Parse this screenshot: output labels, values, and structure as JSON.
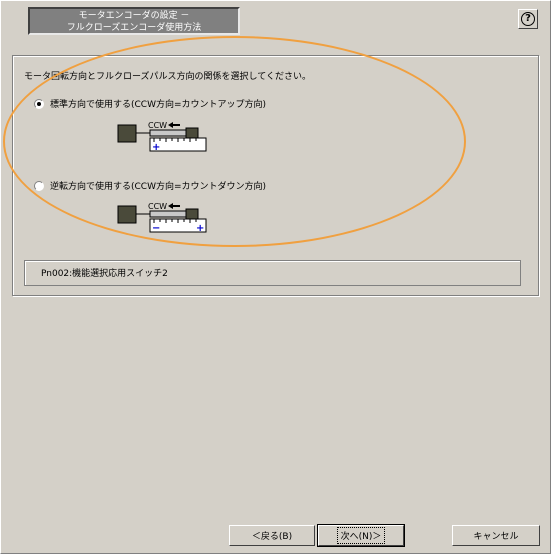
{
  "window": {
    "title_line1": "モータエンコーダの設定 －",
    "title_line2": "フルクローズエンコーダ使用方法"
  },
  "instruction": "モータ回転方向とフルクローズパルス方向の関係を選択してください。",
  "options": [
    {
      "label": "標準方向で使用する(CCW方向=カウントアップ方向)",
      "selected": true,
      "diagram_label": "CCW",
      "left_sign": "+",
      "right_sign": ""
    },
    {
      "label": "逆転方向で使用する(CCW方向=カウントダウン方向)",
      "selected": false,
      "diagram_label": "CCW",
      "left_sign": "−",
      "right_sign": "+"
    }
  ],
  "parameter_text": "Pn002:機能選択応用スイッチ2",
  "buttons": {
    "back": "＜戻る(B)",
    "next": "次へ(N)＞",
    "cancel": "キャンセル"
  },
  "colors": {
    "background": "#d4d0c8",
    "accent_blue": "#0000cc",
    "highlight_orange": "#f0a040"
  }
}
